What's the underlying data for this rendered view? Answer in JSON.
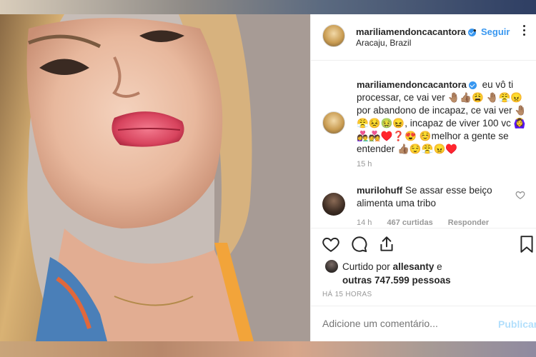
{
  "post": {
    "username": "mariliamendoncacantora",
    "follow_label": "Seguir",
    "separator": "•",
    "location": "Aracaju, Brazil",
    "caption_username": "mariliamendoncacantora",
    "caption_text": "eu vô ti processar, ce vai ver 🤚🏽👍🏽😩 🤚🏽😤😠 por abandono de incapaz, ce vai ver 🤚🏽😤😣🤢😖, incapaz de viver 100 vc 🙆‍♀️👩‍❤️‍👨💑♥️❓😍 ☺️melhor a gente se entender 👍🏽😌😤😠♥️",
    "caption_time": "15 h"
  },
  "comment": {
    "username": "murilohuff",
    "text": "Se assar esse beiço alimenta uma tribo",
    "time": "14 h",
    "likes": "467 curtidas",
    "reply_label": "Responder"
  },
  "likes": {
    "prefix": "Curtido por",
    "user": "allesanty",
    "middle": "e",
    "others": "outras 747.599 pessoas"
  },
  "posted_time": "HÁ 15 HORAS",
  "add_comment": {
    "placeholder": "Adicione um comentário...",
    "publish_label": "Publicar"
  },
  "icons": {
    "more": "more-options-icon",
    "like": "heart-icon",
    "comment": "comment-icon",
    "share": "share-icon",
    "save": "bookmark-icon",
    "verified": "verified-badge-icon"
  },
  "colors": {
    "link_blue": "#3897f0",
    "publish_disabled": "#b2dffc",
    "muted": "#999999"
  }
}
